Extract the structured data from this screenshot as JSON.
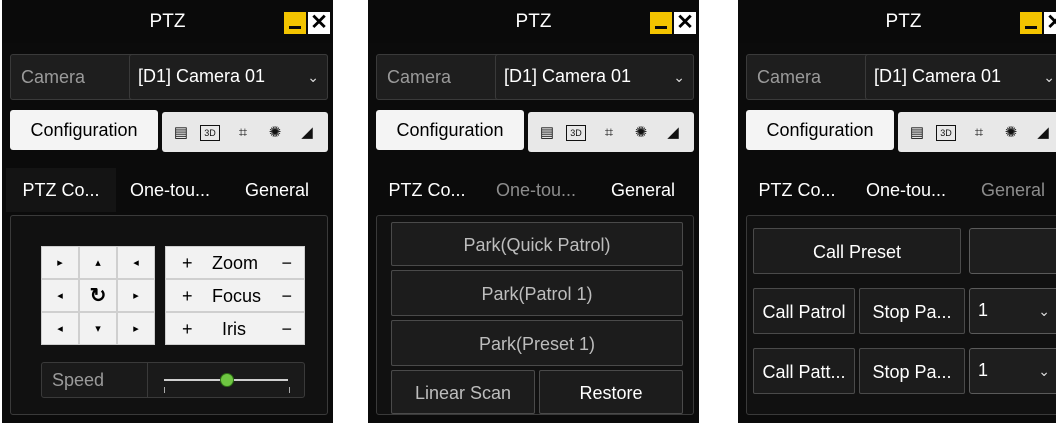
{
  "panels": [
    {
      "title": "PTZ",
      "camera_label": "Camera",
      "camera_value": "[D1] Camera 01",
      "configuration_label": "Configuration",
      "tabs": [
        "PTZ Co...",
        "One-tou...",
        "General"
      ],
      "active_tab": 0,
      "controls": {
        "zoom": "Zoom",
        "focus": "Focus",
        "iris": "Iris",
        "plus": "+",
        "minus": "−"
      },
      "speed_label": "Speed",
      "speed_level": 0.5
    },
    {
      "title": "PTZ",
      "camera_label": "Camera",
      "camera_value": "[D1] Camera 01",
      "configuration_label": "Configuration",
      "tabs": [
        "PTZ Co...",
        "One-tou...",
        "General"
      ],
      "active_tab": 1,
      "buttons": [
        "Park(Quick Patrol)",
        "Park(Patrol 1)",
        "Park(Preset 1)"
      ],
      "linear_scan": "Linear Scan",
      "restore": "Restore"
    },
    {
      "title": "PTZ",
      "camera_label": "Camera",
      "camera_value": "[D1] Camera 01",
      "configuration_label": "Configuration",
      "tabs": [
        "PTZ Co...",
        "One-tou...",
        "General"
      ],
      "active_tab": 2,
      "call_preset": "Call Preset",
      "call_patrol": "Call Patrol",
      "stop_patrol": "Stop Pa...",
      "patrol_number": "1",
      "call_pattern": "Call Patt...",
      "stop_pattern": "Stop Pa...",
      "pattern_number": "1"
    }
  ],
  "colors": {
    "panel_bg": "#0b0b0b",
    "minimize_yellow": "#f3c400",
    "speed_knob": "#6ec641"
  }
}
